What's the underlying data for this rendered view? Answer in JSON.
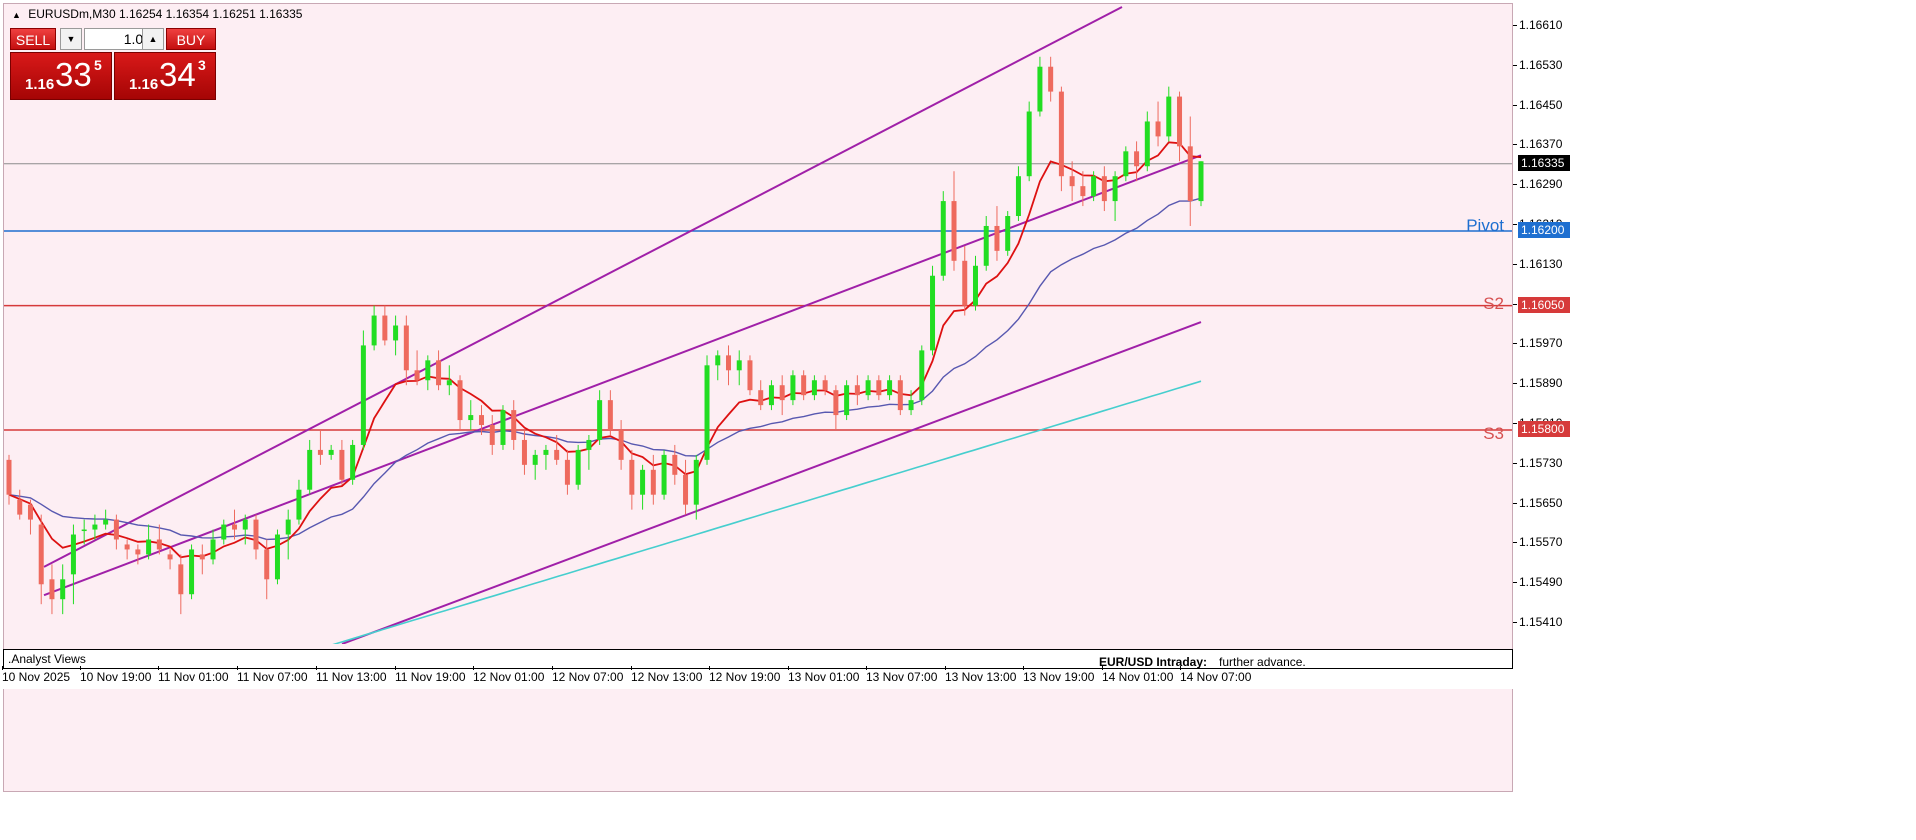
{
  "symbol": {
    "title": "EURUSDm,M30",
    "ohlc": "1.16254 1.16354 1.16251 1.16335"
  },
  "trade_panel": {
    "sell_label": "SELL",
    "buy_label": "BUY",
    "lot_value": "1.00",
    "sell_price_prefix": "1.16",
    "sell_price_big": "33",
    "sell_price_sup": "5",
    "buy_price_prefix": "1.16",
    "buy_price_big": "34",
    "buy_price_sup": "3"
  },
  "price_axis": {
    "ticks": [
      "1.16610",
      "1.16530",
      "1.16450",
      "1.16370",
      "1.16290",
      "1.16210",
      "1.16130",
      "1.16050",
      "1.15970",
      "1.15890",
      "1.15810",
      "1.15730",
      "1.15650",
      "1.15570",
      "1.15490",
      "1.15410"
    ],
    "current_price": "1.16335",
    "pivot_price": "1.16200",
    "s2_price": "1.16050",
    "s3_price": "1.15800"
  },
  "levels": {
    "pivot_label": "Pivot",
    "s2_label": "S2",
    "s3_label": "S3"
  },
  "colors": {
    "bg": "#fdeef3",
    "bull": "#22dd22",
    "bear": "#ee6a5e",
    "channel": "#a020a8",
    "ma_fast": "#dd1111",
    "ma_mid": "#5858b0",
    "ma_slow": "#46cece",
    "pivot": "#1e6fd0",
    "support": "#d63a3a"
  },
  "time_axis": {
    "labels": [
      "10 Nov 2025",
      "10 Nov 19:00",
      "11 Nov 01:00",
      "11 Nov 07:00",
      "11 Nov 13:00",
      "11 Nov 19:00",
      "12 Nov 01:00",
      "12 Nov 07:00",
      "12 Nov 13:00",
      "12 Nov 19:00",
      "13 Nov 01:00",
      "13 Nov 07:00",
      "13 Nov 13:00",
      "13 Nov 19:00",
      "14 Nov 01:00",
      "14 Nov 07:00"
    ]
  },
  "indicator_panel": {
    "label": ".Analyst Views",
    "intraday_title": "EUR/USD Intraday:",
    "intraday_text": "further advance.",
    "scale_top": "1",
    "scale_bottom": "0"
  },
  "chart_data": {
    "type": "candlestick",
    "symbol": "EURUSDm",
    "timeframe": "M30",
    "y_range": [
      1.1537,
      1.1665
    ],
    "candles_ohlc": [
      [
        1.1574,
        1.1575,
        1.1565,
        1.1567
      ],
      [
        1.1566,
        1.1568,
        1.1562,
        1.1563
      ],
      [
        1.1565,
        1.1566,
        1.1559,
        1.1562
      ],
      [
        1.1561,
        1.1563,
        1.1545,
        1.1549
      ],
      [
        1.155,
        1.1553,
        1.1543,
        1.1546
      ],
      [
        1.1546,
        1.1553,
        1.1543,
        1.155
      ],
      [
        1.1551,
        1.1561,
        1.1545,
        1.1559
      ],
      [
        1.156,
        1.1562,
        1.1557,
        1.156
      ],
      [
        1.156,
        1.1563,
        1.1558,
        1.1561
      ],
      [
        1.1561,
        1.1564,
        1.156,
        1.1562
      ],
      [
        1.1562,
        1.1563,
        1.1556,
        1.1558
      ],
      [
        1.1557,
        1.1558,
        1.1554,
        1.1556
      ],
      [
        1.1556,
        1.1557,
        1.1553,
        1.1555
      ],
      [
        1.1555,
        1.1561,
        1.1554,
        1.1558
      ],
      [
        1.1558,
        1.1561,
        1.1555,
        1.1556
      ],
      [
        1.1555,
        1.1556,
        1.1552,
        1.1554
      ],
      [
        1.1553,
        1.1555,
        1.1543,
        1.1547
      ],
      [
        1.1547,
        1.1557,
        1.1546,
        1.1556
      ],
      [
        1.1555,
        1.1557,
        1.1551,
        1.1554
      ],
      [
        1.1554,
        1.156,
        1.1553,
        1.1558
      ],
      [
        1.1558,
        1.1562,
        1.1557,
        1.1561
      ],
      [
        1.1561,
        1.1564,
        1.1558,
        1.156
      ],
      [
        1.156,
        1.1563,
        1.1557,
        1.1562
      ],
      [
        1.1562,
        1.1563,
        1.1554,
        1.1556
      ],
      [
        1.1556,
        1.1558,
        1.1546,
        1.155
      ],
      [
        1.155,
        1.156,
        1.1549,
        1.1559
      ],
      [
        1.1559,
        1.1564,
        1.1554,
        1.1562
      ],
      [
        1.1562,
        1.157,
        1.1561,
        1.1568
      ],
      [
        1.1568,
        1.1578,
        1.1567,
        1.1576
      ],
      [
        1.1576,
        1.158,
        1.1573,
        1.1575
      ],
      [
        1.1575,
        1.1577,
        1.1574,
        1.1576
      ],
      [
        1.1576,
        1.1578,
        1.1569,
        1.157
      ],
      [
        1.157,
        1.1578,
        1.1569,
        1.1577
      ],
      [
        1.1577,
        1.16,
        1.1576,
        1.1597
      ],
      [
        1.1597,
        1.1605,
        1.1596,
        1.1603
      ],
      [
        1.1603,
        1.1605,
        1.1597,
        1.1598
      ],
      [
        1.1598,
        1.1603,
        1.1595,
        1.1601
      ],
      [
        1.1601,
        1.1603,
        1.1589,
        1.1592
      ],
      [
        1.1592,
        1.1596,
        1.1589,
        1.159
      ],
      [
        1.159,
        1.1595,
        1.1588,
        1.1594
      ],
      [
        1.1594,
        1.1596,
        1.1588,
        1.1589
      ],
      [
        1.1589,
        1.1593,
        1.1587,
        1.159
      ],
      [
        1.159,
        1.1591,
        1.158,
        1.1582
      ],
      [
        1.1582,
        1.1586,
        1.158,
        1.1583
      ],
      [
        1.1583,
        1.1585,
        1.1579,
        1.1581
      ],
      [
        1.1581,
        1.1583,
        1.1575,
        1.1577
      ],
      [
        1.1577,
        1.1585,
        1.1576,
        1.1584
      ],
      [
        1.1584,
        1.1586,
        1.1576,
        1.1578
      ],
      [
        1.1578,
        1.158,
        1.1571,
        1.1573
      ],
      [
        1.1573,
        1.1576,
        1.157,
        1.1575
      ],
      [
        1.1575,
        1.1577,
        1.1572,
        1.1576
      ],
      [
        1.1576,
        1.1579,
        1.1573,
        1.1574
      ],
      [
        1.1574,
        1.1576,
        1.1567,
        1.1569
      ],
      [
        1.1569,
        1.1577,
        1.1568,
        1.1576
      ],
      [
        1.1576,
        1.1579,
        1.1572,
        1.1578
      ],
      [
        1.1578,
        1.1588,
        1.1577,
        1.1586
      ],
      [
        1.1586,
        1.1588,
        1.1579,
        1.158
      ],
      [
        1.158,
        1.1582,
        1.1572,
        1.1574
      ],
      [
        1.1574,
        1.1576,
        1.1564,
        1.1567
      ],
      [
        1.1567,
        1.1573,
        1.1564,
        1.1572
      ],
      [
        1.1572,
        1.1575,
        1.1565,
        1.1567
      ],
      [
        1.1567,
        1.1576,
        1.1566,
        1.1575
      ],
      [
        1.1575,
        1.1577,
        1.1569,
        1.1571
      ],
      [
        1.1571,
        1.1574,
        1.1563,
        1.1565
      ],
      [
        1.1565,
        1.1575,
        1.1562,
        1.1574
      ],
      [
        1.1574,
        1.1595,
        1.1573,
        1.1593
      ],
      [
        1.1593,
        1.1596,
        1.159,
        1.1595
      ],
      [
        1.1595,
        1.1597,
        1.1589,
        1.1592
      ],
      [
        1.1592,
        1.1596,
        1.1589,
        1.1594
      ],
      [
        1.1594,
        1.1595,
        1.1587,
        1.1588
      ],
      [
        1.1588,
        1.159,
        1.1584,
        1.1585
      ],
      [
        1.1585,
        1.159,
        1.1584,
        1.1589
      ],
      [
        1.1589,
        1.1591,
        1.1583,
        1.1586
      ],
      [
        1.1586,
        1.1592,
        1.1585,
        1.1591
      ],
      [
        1.1591,
        1.1592,
        1.1586,
        1.1587
      ],
      [
        1.1587,
        1.1591,
        1.1586,
        1.159
      ],
      [
        1.159,
        1.1591,
        1.1587,
        1.1588
      ],
      [
        1.1588,
        1.1589,
        1.158,
        1.1583
      ],
      [
        1.1583,
        1.159,
        1.1582,
        1.1589
      ],
      [
        1.1589,
        1.1591,
        1.1585,
        1.1587
      ],
      [
        1.1587,
        1.1591,
        1.1586,
        1.159
      ],
      [
        1.159,
        1.1591,
        1.1586,
        1.1587
      ],
      [
        1.1587,
        1.1591,
        1.1586,
        1.159
      ],
      [
        1.159,
        1.1591,
        1.1583,
        1.1584
      ],
      [
        1.1584,
        1.1588,
        1.1583,
        1.1586
      ],
      [
        1.1586,
        1.1597,
        1.1585,
        1.1596
      ],
      [
        1.1596,
        1.1613,
        1.1595,
        1.1611
      ],
      [
        1.1611,
        1.1628,
        1.161,
        1.1626
      ],
      [
        1.1626,
        1.1632,
        1.1612,
        1.1614
      ],
      [
        1.1614,
        1.1617,
        1.1603,
        1.1605
      ],
      [
        1.1605,
        1.1615,
        1.1604,
        1.1613
      ],
      [
        1.1613,
        1.1623,
        1.1612,
        1.1621
      ],
      [
        1.1621,
        1.1625,
        1.1614,
        1.1616
      ],
      [
        1.1616,
        1.1624,
        1.1615,
        1.1623
      ],
      [
        1.1623,
        1.1633,
        1.1622,
        1.1631
      ],
      [
        1.1631,
        1.1646,
        1.163,
        1.1644
      ],
      [
        1.1644,
        1.1655,
        1.1643,
        1.1653
      ],
      [
        1.1653,
        1.1655,
        1.1646,
        1.1648
      ],
      [
        1.1648,
        1.1649,
        1.1628,
        1.1631
      ],
      [
        1.1631,
        1.1634,
        1.1626,
        1.1629
      ],
      [
        1.1629,
        1.1632,
        1.1625,
        1.1627
      ],
      [
        1.1627,
        1.1632,
        1.1626,
        1.1631
      ],
      [
        1.1631,
        1.1633,
        1.1624,
        1.1626
      ],
      [
        1.1626,
        1.1632,
        1.1622,
        1.1631
      ],
      [
        1.1631,
        1.1637,
        1.163,
        1.1636
      ],
      [
        1.1636,
        1.1638,
        1.163,
        1.1633
      ],
      [
        1.1633,
        1.1644,
        1.1632,
        1.1642
      ],
      [
        1.1642,
        1.1646,
        1.1637,
        1.1639
      ],
      [
        1.1639,
        1.1649,
        1.1638,
        1.1647
      ],
      [
        1.1647,
        1.1648,
        1.1634,
        1.1637
      ],
      [
        1.1637,
        1.1643,
        1.1621,
        1.1626
      ],
      [
        1.1626,
        1.1634,
        1.1625,
        1.1634
      ]
    ],
    "overlays": [
      "MA fast (red)",
      "MA medium (purple)",
      "MA slow (cyan)",
      "Ascending channel (magenta)"
    ],
    "levels": [
      {
        "label": "Pivot",
        "value": 1.162
      },
      {
        "label": "S2",
        "value": 1.1605
      },
      {
        "label": "S3",
        "value": 1.158
      }
    ],
    "last_price": 1.16335
  }
}
